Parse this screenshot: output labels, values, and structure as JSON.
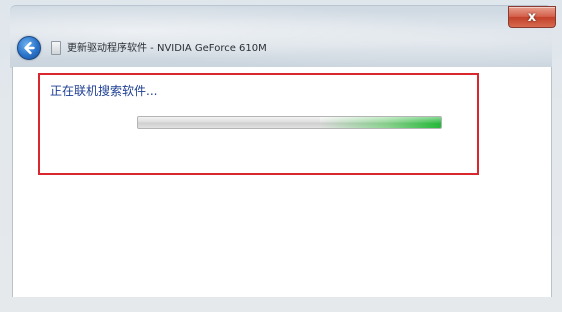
{
  "window": {
    "title": "更新驱动程序软件 - NVIDIA GeForce 610M",
    "close_label": "x"
  },
  "status": {
    "message": "正在联机搜索软件..."
  },
  "progress": {
    "mode": "indeterminate",
    "glow_end_fraction": 1.0
  },
  "colors": {
    "highlight_border": "#d9272e",
    "status_text": "#1e3f92",
    "progress_glow": "#25b83a",
    "close_button": "#c2412a"
  },
  "icons": {
    "back": "back-arrow-icon",
    "title": "driver-device-icon",
    "close": "close-icon"
  }
}
